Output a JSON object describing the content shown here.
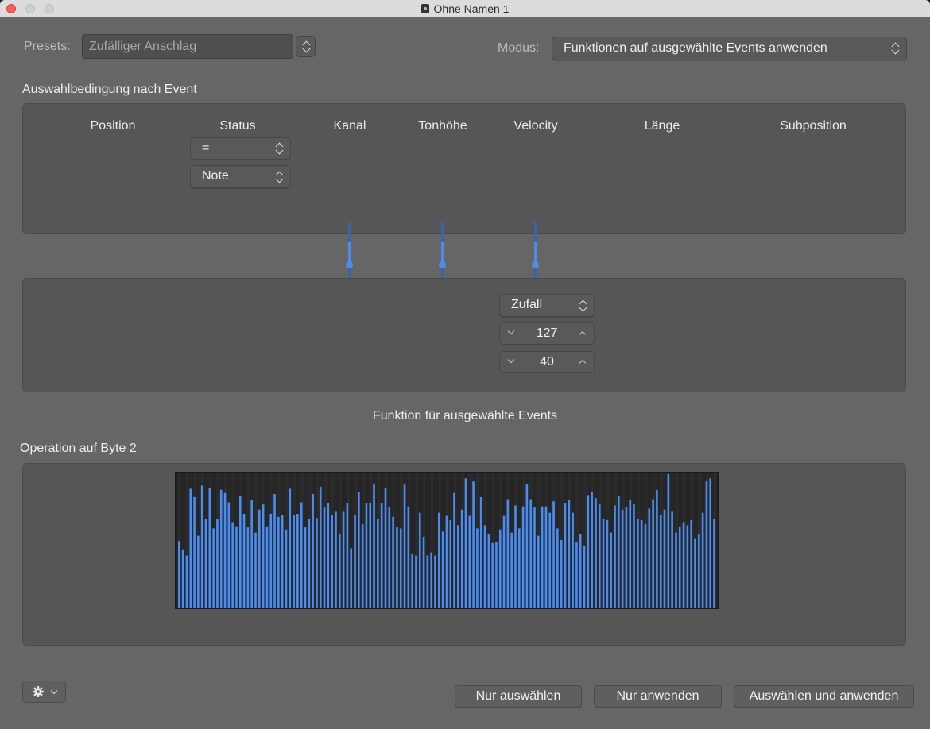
{
  "window": {
    "title": "Ohne Namen 1"
  },
  "presets": {
    "label": "Presets:",
    "value": "Zufälliger Anschlag"
  },
  "modus": {
    "label": "Modus:",
    "value": "Funktionen auf ausgewählte Events anwenden"
  },
  "selection": {
    "heading": "Auswahlbedingung nach Event",
    "columns": [
      "Position",
      "Status",
      "Kanal",
      "Tonhöhe",
      "Velocity",
      "Länge",
      "Subposition"
    ],
    "status_operator": "=",
    "status_value": "Note"
  },
  "operation": {
    "velocity_mode": "Zufall",
    "value1": "127",
    "value2": "40"
  },
  "function_label": "Funktion für ausgewählte Events",
  "byte_operation": {
    "label": "Operation auf Byte 2",
    "bar_color": "#4a8cf0",
    "graph_max": 127,
    "values": [
      66,
      58,
      52,
      116,
      108,
      71,
      119,
      87,
      117,
      78,
      87,
      115,
      112,
      103,
      84,
      80,
      109,
      92,
      79,
      105,
      74,
      96,
      101,
      80,
      92,
      111,
      89,
      91,
      77,
      116,
      91,
      92,
      103,
      79,
      87,
      111,
      88,
      118,
      98,
      102,
      91,
      94,
      73,
      94,
      102,
      59,
      91,
      113,
      82,
      102,
      102,
      121,
      87,
      102,
      117,
      98,
      89,
      79,
      78,
      120,
      99,
      54,
      52,
      93,
      70,
      52,
      55,
      52,
      93,
      75,
      90,
      86,
      112,
      81,
      96,
      126,
      90,
      123,
      78,
      108,
      81,
      73,
      64,
      65,
      77,
      90,
      106,
      74,
      100,
      78,
      99,
      120,
      106,
      98,
      71,
      99,
      99,
      93,
      104,
      78,
      67,
      102,
      105,
      93,
      65,
      73,
      61,
      110,
      113,
      107,
      101,
      87,
      86,
      74,
      100,
      109,
      96,
      98,
      105,
      101,
      87,
      86,
      82,
      97,
      106,
      115,
      91,
      96,
      130,
      94,
      74,
      80,
      84,
      81,
      86,
      68,
      73,
      93,
      123,
      126,
      87
    ]
  },
  "buttons": {
    "select_only": "Nur auswählen",
    "apply_only": "Nur anwenden",
    "select_and_apply": "Auswählen und anwenden"
  },
  "icons": {
    "gear": "gear-icon",
    "chevron": "chevron-down-icon"
  }
}
